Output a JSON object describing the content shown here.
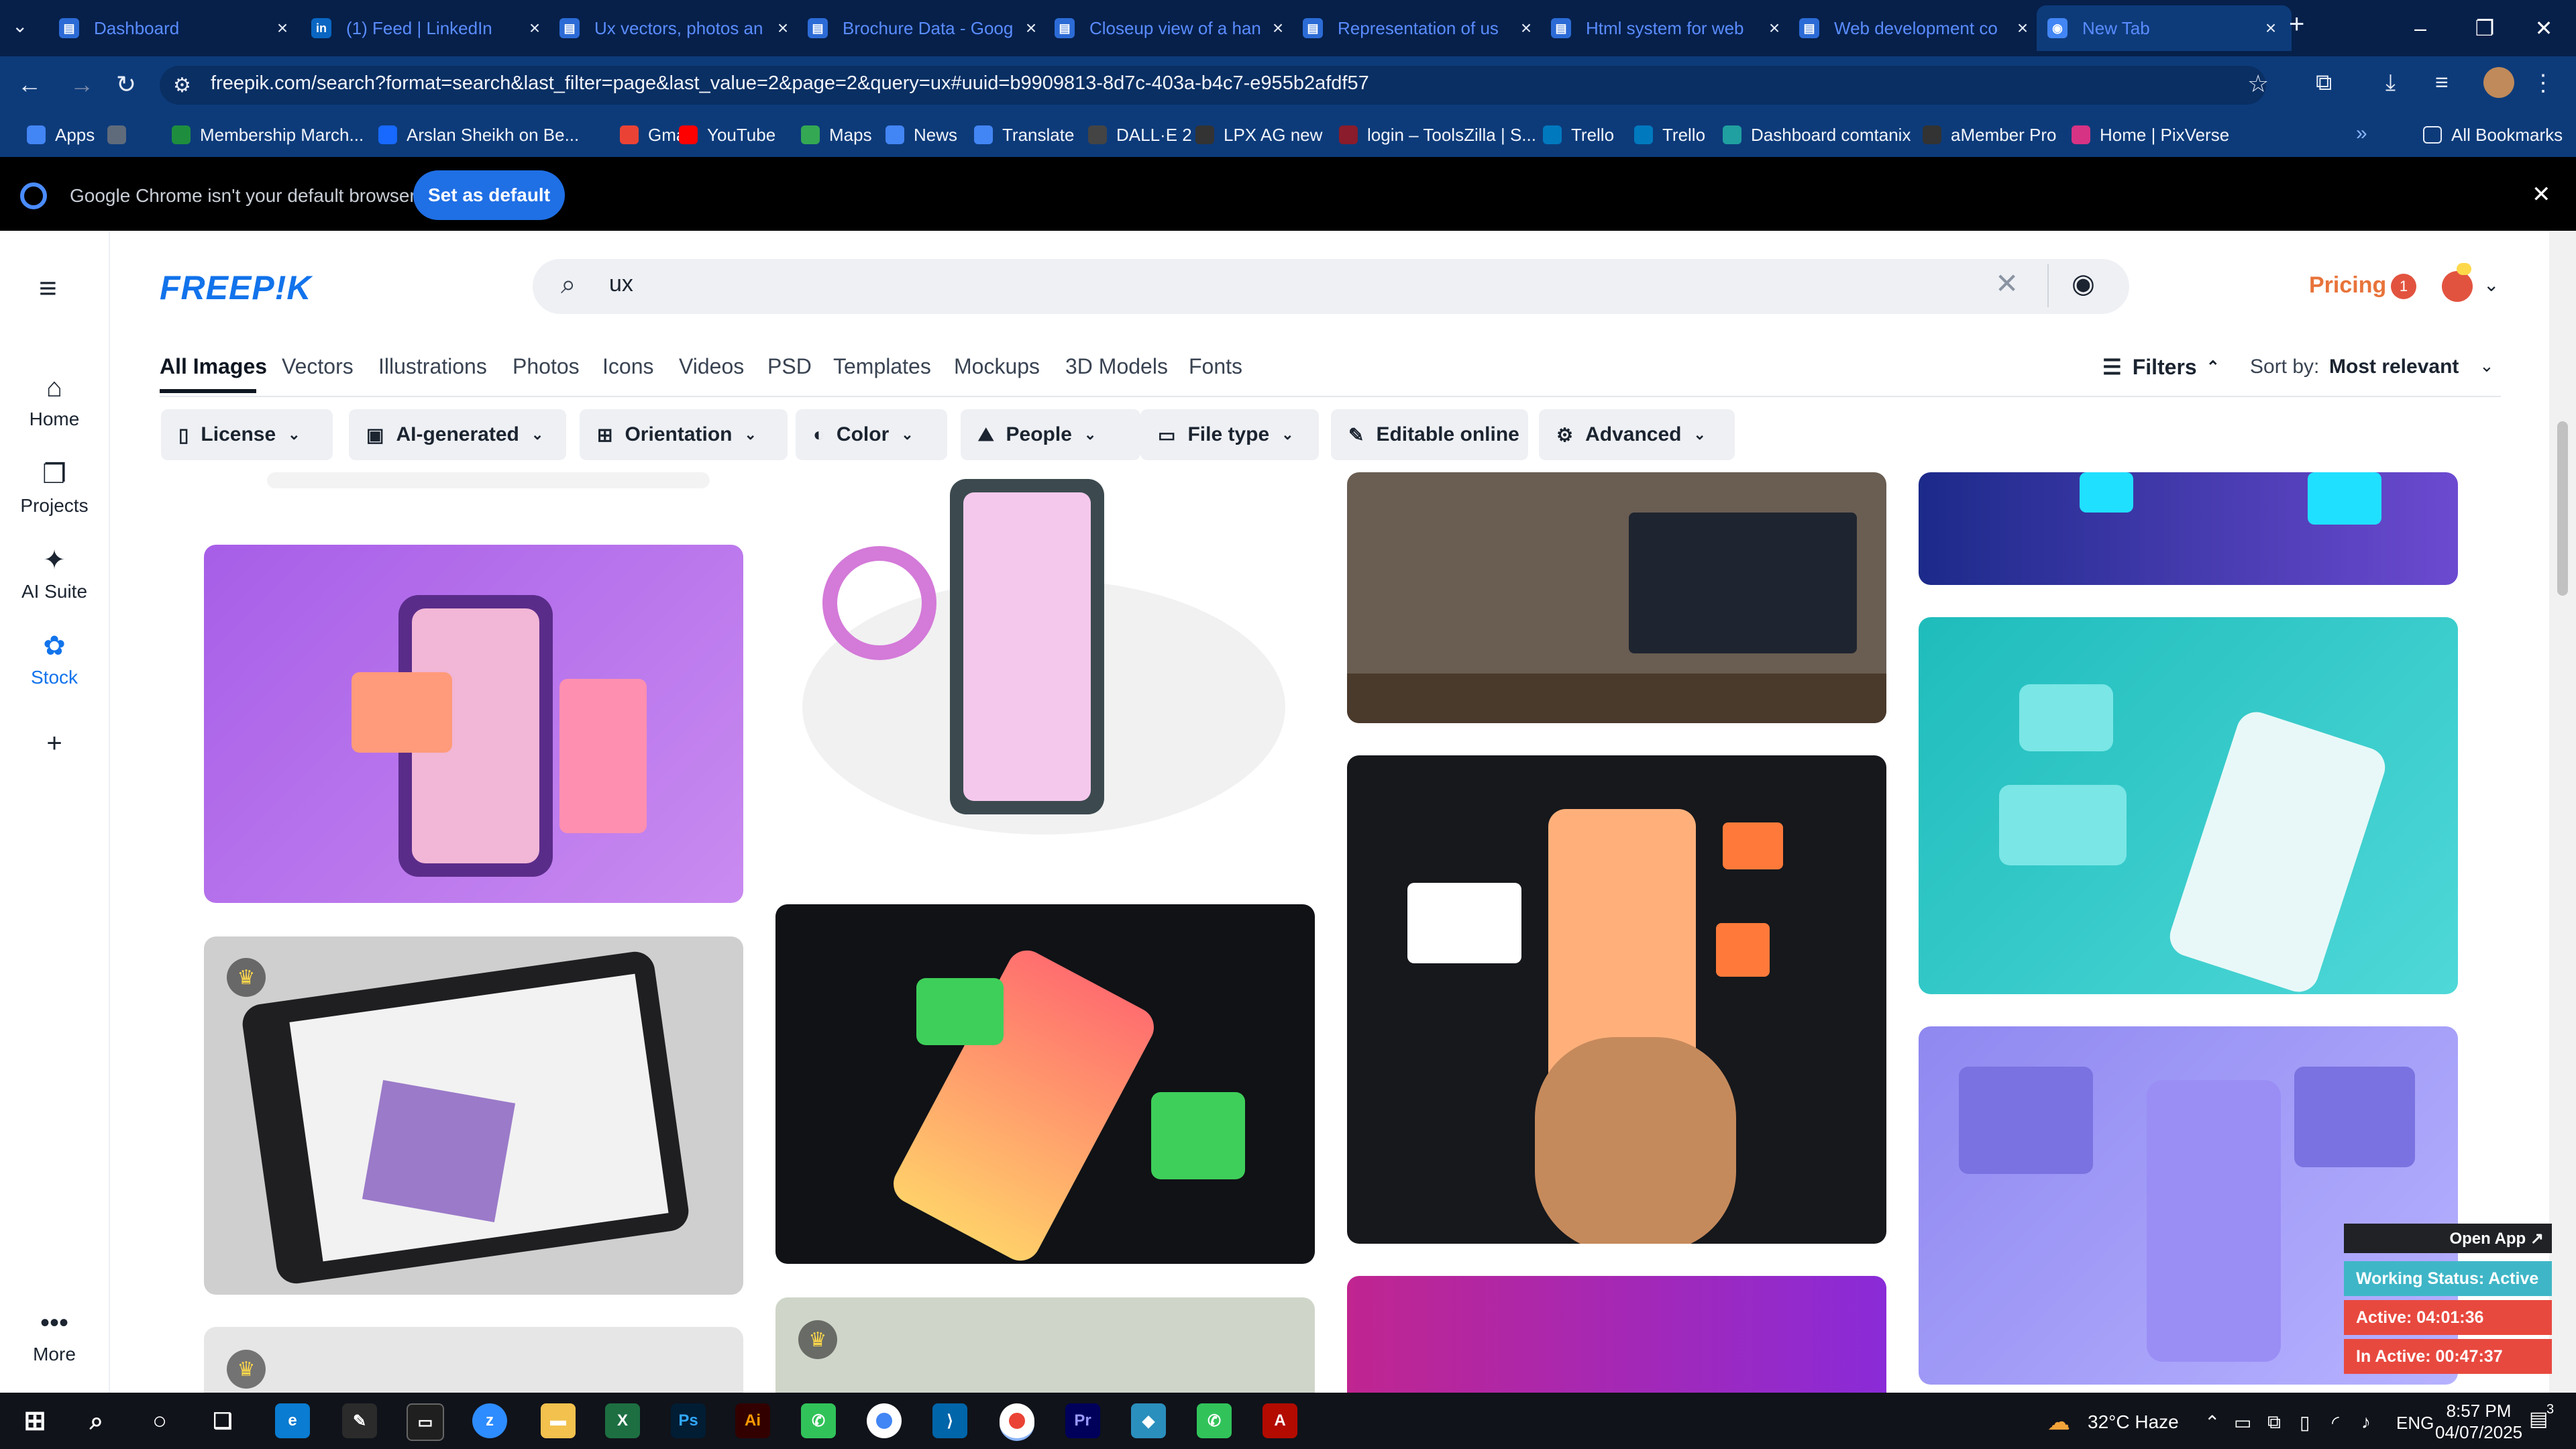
{
  "tabs": [
    {
      "title": "Dashboard",
      "color": "#2c6bd6",
      "glyph": "▤"
    },
    {
      "title": "(1) Feed | LinkedIn",
      "color": "#0a66c2",
      "glyph": "in"
    },
    {
      "title": "Ux vectors, photos an",
      "color": "#2c6bd6",
      "glyph": "▤"
    },
    {
      "title": "Brochure Data - Goog",
      "color": "#2c6bd6",
      "glyph": "▤"
    },
    {
      "title": "Closeup view of a han",
      "color": "#2c6bd6",
      "glyph": "▤"
    },
    {
      "title": "Representation of us",
      "color": "#2c6bd6",
      "glyph": "▤"
    },
    {
      "title": "Html system for web",
      "color": "#2c6bd6",
      "glyph": "▤"
    },
    {
      "title": "Web development co",
      "color": "#2c6bd6",
      "glyph": "▤"
    },
    {
      "title": "New Tab",
      "color": "#4285f4",
      "glyph": "◉"
    }
  ],
  "address": {
    "url": "freepik.com/search?format=search&last_filter=page&last_value=2&page=2&query=ux#uuid=b9909813-8d7c-403a-b4c7-e955b2afdf57"
  },
  "bookmarks": [
    {
      "label": "Apps",
      "color": "#4285f4"
    },
    {
      "label": "",
      "color": "#5f6b7a"
    },
    {
      "label": "Membership March...",
      "color": "#1e8e3e"
    },
    {
      "label": "Arslan Sheikh on Be...",
      "color": "#1769ff"
    },
    {
      "label": "Gmail",
      "color": "#ea4335"
    },
    {
      "label": "YouTube",
      "color": "#ff0000"
    },
    {
      "label": "Maps",
      "color": "#34a853"
    },
    {
      "label": "News",
      "color": "#4285f4"
    },
    {
      "label": "Translate",
      "color": "#4285f4"
    },
    {
      "label": "DALL·E 2",
      "color": "#444444"
    },
    {
      "label": "LPX AG new",
      "color": "#333333"
    },
    {
      "label": "login – ToolsZilla | S...",
      "color": "#8a1c2b"
    },
    {
      "label": "Trello",
      "color": "#0079bf"
    },
    {
      "label": "Trello",
      "color": "#0079bf"
    },
    {
      "label": "Dashboard comtanix",
      "color": "#20a0a0"
    },
    {
      "label": "aMember Pro",
      "color": "#333333"
    },
    {
      "label": "Home | PixVerse",
      "color": "#d63384"
    }
  ],
  "all_bookmarks": "All Bookmarks",
  "infobar": {
    "text": "Google Chrome isn't your default browser",
    "button": "Set as default"
  },
  "rail": [
    {
      "label": "Home",
      "icon": "⌂"
    },
    {
      "label": "Projects",
      "icon": "❐"
    },
    {
      "label": "AI Suite",
      "icon": "✦"
    },
    {
      "label": "Stock",
      "icon": "✿"
    },
    {
      "label": "",
      "icon": "+"
    }
  ],
  "rail_more": "More",
  "brand": {
    "logo": "FREEP!K",
    "accent": "#1273eb"
  },
  "search": {
    "value": "ux"
  },
  "header": {
    "pricing": "Pricing",
    "notifications": "1"
  },
  "categories": [
    "All Images",
    "Vectors",
    "Illustrations",
    "Photos",
    "Icons",
    "Videos",
    "PSD",
    "Templates",
    "Mockups",
    "3D Models",
    "Fonts"
  ],
  "filters_label": "Filters",
  "sort": {
    "label": "Sort by:",
    "value": "Most relevant"
  },
  "filter_chips": [
    {
      "label": "License",
      "icon": "▯"
    },
    {
      "label": "AI-generated",
      "icon": "▣"
    },
    {
      "label": "Orientation",
      "icon": "⊞"
    },
    {
      "label": "Color",
      "icon": "◐"
    },
    {
      "label": "People",
      "icon": "⛰"
    },
    {
      "label": "File type",
      "icon": "▭"
    },
    {
      "label": "Editable online",
      "icon": "✎"
    },
    {
      "label": "Advanced",
      "icon": "⚙"
    }
  ],
  "widget": {
    "open_app": "Open App ↗",
    "status": "Working Status: Active",
    "active": "Active: 04:01:36",
    "inactive": "In Active: 00:47:37"
  },
  "taskbar": {
    "weather": "32°C Haze",
    "lang": "ENG",
    "time": "8:57 PM",
    "date": "04/07/2025",
    "notifications": "3"
  }
}
